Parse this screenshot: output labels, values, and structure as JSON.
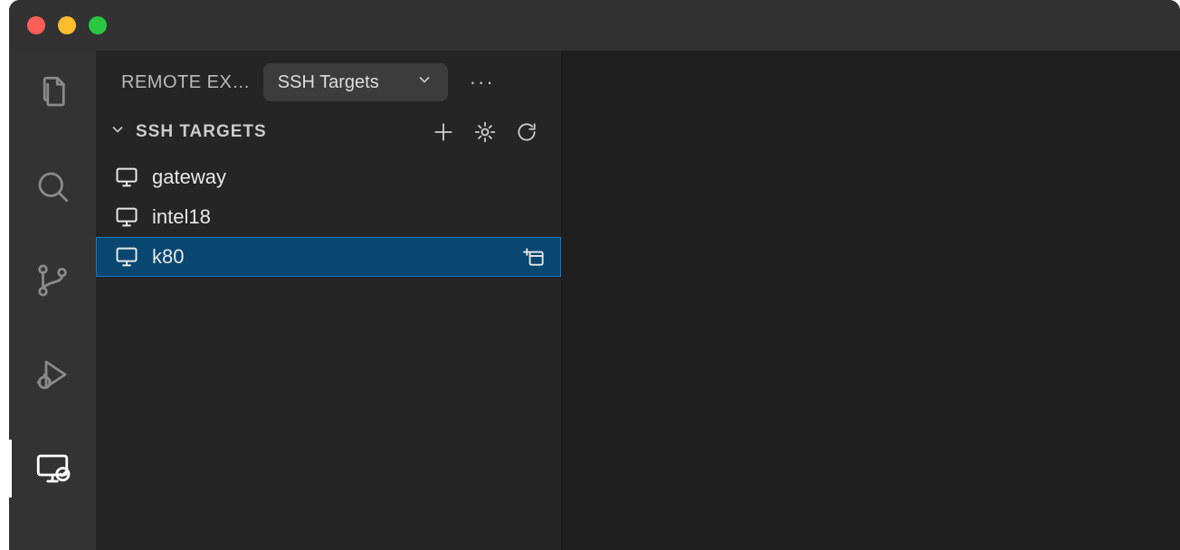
{
  "header": {
    "title": "REMOTE EXPLORER",
    "title_truncated": "REMOTE EX…",
    "select_label": "SSH Targets"
  },
  "section": {
    "label": "SSH TARGETS"
  },
  "targets": [
    {
      "name": "gateway",
      "selected": false
    },
    {
      "name": "intel18",
      "selected": false
    },
    {
      "name": "k80",
      "selected": true
    }
  ]
}
